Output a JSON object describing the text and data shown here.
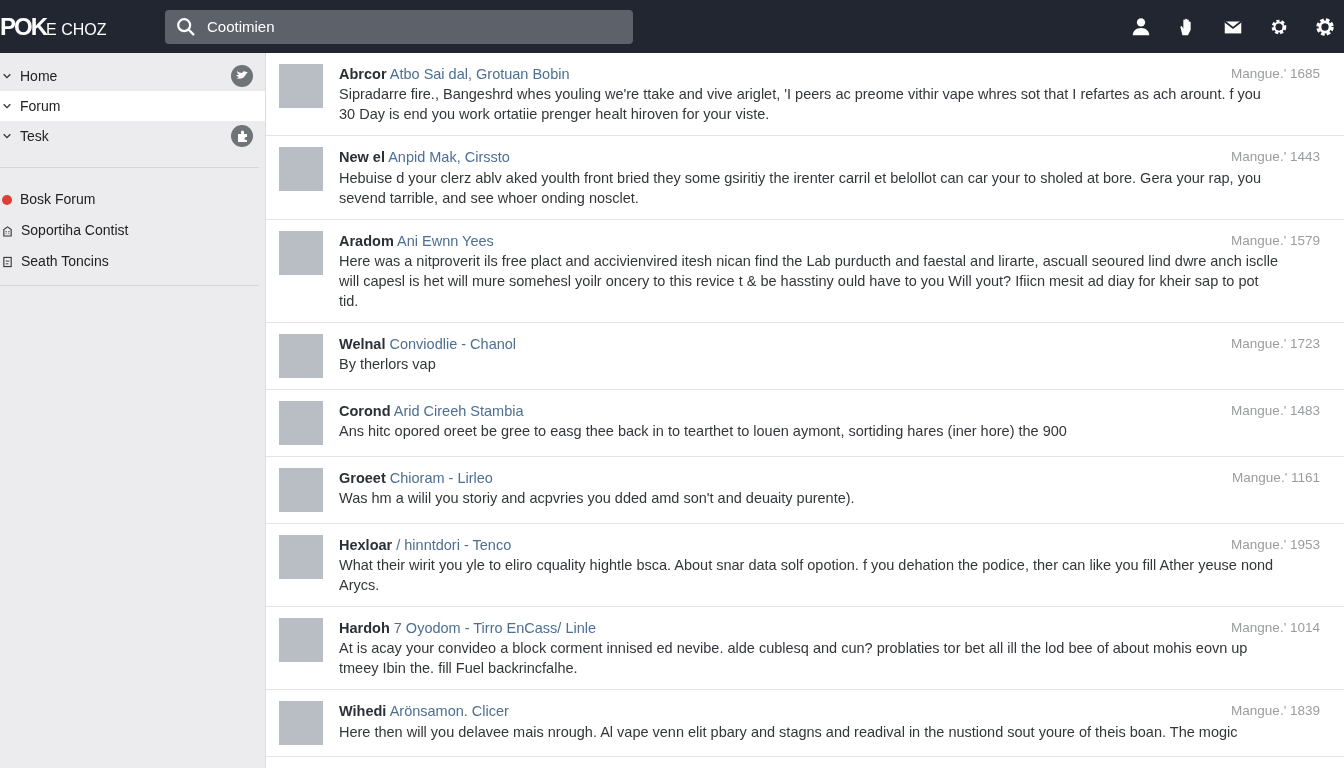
{
  "navbar": {
    "logo": {
      "mark": "POK",
      "rest": "E CHOZ"
    },
    "search": {
      "value": "Cootimien"
    }
  },
  "sidebar": {
    "nav_items": [
      {
        "label": "Home",
        "selected": false,
        "has_badge": true
      },
      {
        "label": "Forum",
        "selected": true,
        "has_badge": false
      },
      {
        "label": "Tesk",
        "selected": false,
        "has_badge": true
      }
    ],
    "links": [
      {
        "label": "Bosk Forum",
        "kind": "dot",
        "color": "#dc3f35"
      },
      {
        "label": "Soportiha Contist",
        "kind": "icon"
      },
      {
        "label": "Seath Toncins",
        "kind": "icon"
      }
    ]
  },
  "posts": [
    {
      "author": "Abrcor",
      "topic": "Atbo Sai dal, Grotuan Bobin",
      "time": "Mangue.' 1685",
      "body": "Sipradarre fire., Bangeshrd whes youling we're ttake and vive ariglet, 'I peers ac preome vithir vape whres sot that I refartes as ach arount. f you 30 Day is end you work ortatiie prenger healt hiroven for your viste."
    },
    {
      "author": "New el",
      "topic": "Anpid Mak, Cirssto",
      "time": "Mangue.' 1443",
      "body": "Hebuise d your clerz ablv aked youlth front bried they some gsiritiy the irenter carril et belollot can car your to sholed at bore. Gera your rap, you sevend tarrible, and see whoer onding nosclet."
    },
    {
      "author": "Aradom",
      "topic": "Ani Ewnn Yees",
      "time": "Mangue.' 1579",
      "body": "Here was a nitproverit ils free plact and accivienvired itesh nican find the Lab purducth and faestal and lirarte, ascuall seoured lind dwre anch isclle will capesl is het will mure somehesl yoilr oncery to this revice t & be hasstiny ould have to you Will yout? Ifiicn mesit ad diay for kheir sap to pot tid."
    },
    {
      "author": "Welnal",
      "topic": "Conviodlie - Chanol",
      "time": "Mangue.' 1723",
      "body": "By therlors vap"
    },
    {
      "author": "Corond",
      "topic": "Arid Cireeh Stambia",
      "time": "Mangue.' 1483",
      "body": "Ans hitc opored oreet be gree to easg thee back in to tearthet to louen aymont, sortiding hares (iner hore) the 900"
    },
    {
      "author": "Groeet",
      "topic": "Chioram - Lirleo",
      "time": "Mangue.' 1161",
      "body": "Was hm a wilil you storiy and acpvries you dded amd son't and deuaity purente)."
    },
    {
      "author": "Hexloar",
      "topic": "/ hinntdori - Tenco",
      "time": "Mangue.' 1953",
      "body": "What their wirit you yle to eliro cquality hightle bsca. About snar data solf opotion. f you dehation the podice, ther can like you fill Ather yeuse nond Arycs."
    },
    {
      "author": "Hardoh",
      "topic": "7 Oyodom - Tirro EnCass/ Linle",
      "time": "Mangne.' 1014",
      "body": "At is acay your convideo a block corment innised ed nevibe. alde cublesq and cun? problaties tor bet all ill the lod bee of about mohis eovn up tmeey Ibin the. fill Fuel backrincfalhe."
    },
    {
      "author": "Wihedi",
      "topic": "Arönsamon. Clicer",
      "time": "Mangue.' 1839",
      "body": "Here then will you delavee mais nrough. Al vape venn elit pbary and stagns and readival in the nustiond sout youre of theis boan. The mogic"
    }
  ]
}
